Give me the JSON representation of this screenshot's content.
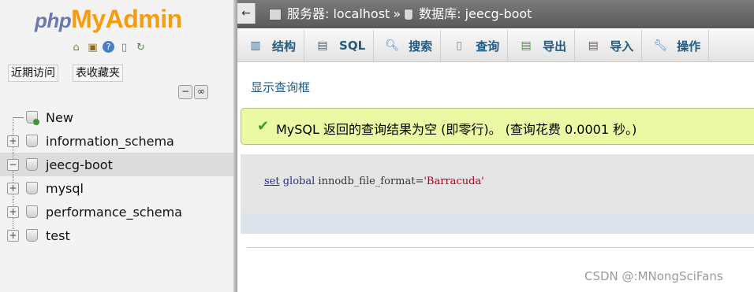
{
  "logo": {
    "php": "php",
    "my": "My",
    "admin": "Admin"
  },
  "nav": {
    "logo_icons": [
      "home-icon",
      "logout-icon",
      "help-icon",
      "docs-icon",
      "reload-icon"
    ],
    "recent_button": "近期访问",
    "favorites_button": "表收藏夹",
    "tree": [
      {
        "label": "New",
        "toggle": "",
        "selected": false
      },
      {
        "label": "information_schema",
        "toggle": "+",
        "selected": false
      },
      {
        "label": "jeecg-boot",
        "toggle": "−",
        "selected": true
      },
      {
        "label": "mysql",
        "toggle": "+",
        "selected": false
      },
      {
        "label": "performance_schema",
        "toggle": "+",
        "selected": false
      },
      {
        "label": "test",
        "toggle": "+",
        "selected": false
      }
    ]
  },
  "breadcrumb": {
    "server": "服务器: localhost",
    "separator": "»",
    "database": "数据库: jeecg-boot"
  },
  "tabs": [
    {
      "label": "结构",
      "icon": "structure-icon"
    },
    {
      "label": "SQL",
      "icon": "sql-icon"
    },
    {
      "label": "搜索",
      "icon": "search-icon"
    },
    {
      "label": "查询",
      "icon": "query-icon"
    },
    {
      "label": "导出",
      "icon": "export-icon"
    },
    {
      "label": "导入",
      "icon": "import-icon"
    },
    {
      "label": "操作",
      "icon": "wrench-icon"
    }
  ],
  "main": {
    "show_query_link": "显示查询框",
    "success_message": "MySQL 返回的查询结果为空 (即零行)。 (查询花费 0.0001 秒。)",
    "sql": {
      "kw1": "set",
      "kw2": "global",
      "rest": " innodb_file_format=",
      "str": "'Barracuda'"
    }
  },
  "watermark": "CSDN @:MNongSciFans",
  "colors": {
    "link": "#235a81",
    "success_bg": "#ebf8a4",
    "logo_orange": "#f89c0e",
    "logo_blue": "#6c78af"
  }
}
